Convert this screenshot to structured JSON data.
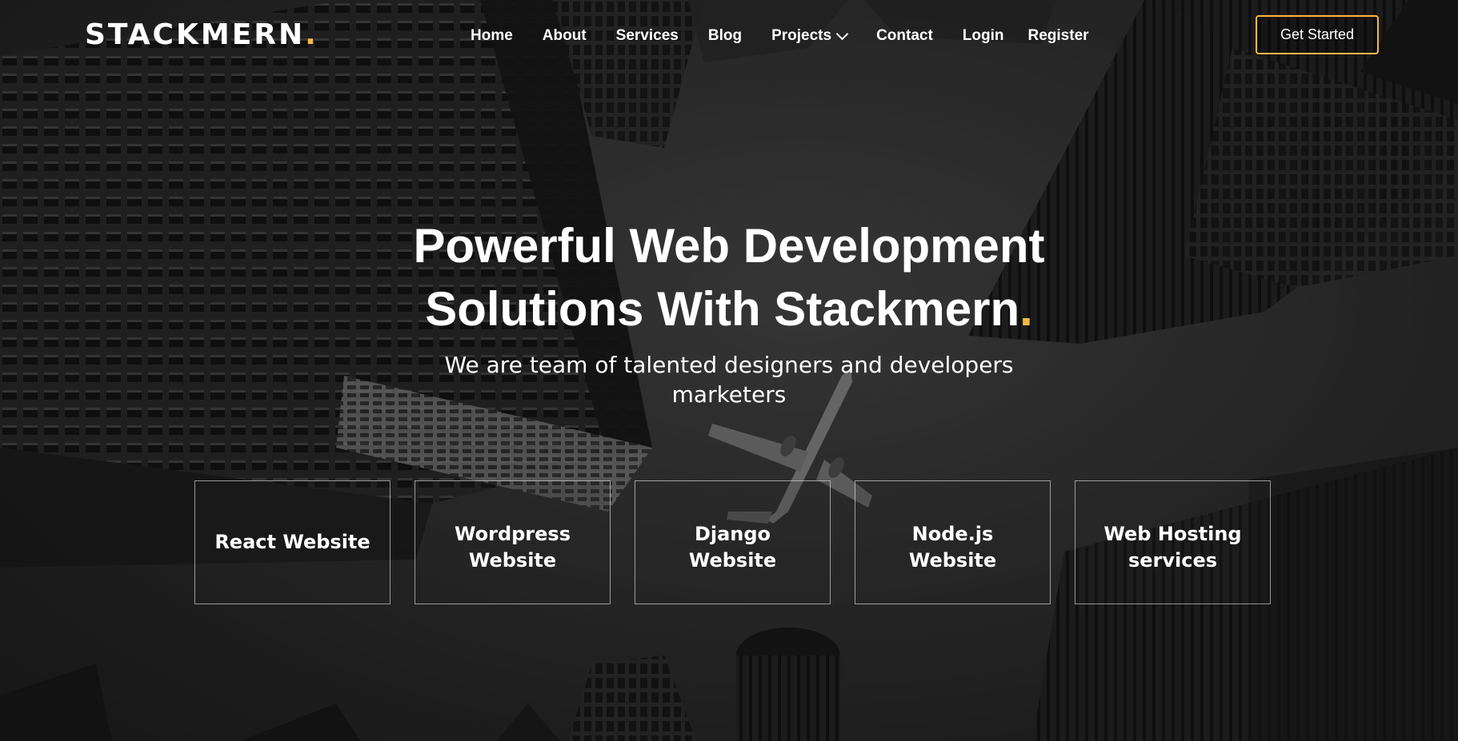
{
  "brand": {
    "name": "STACKMERN",
    "dot": ".",
    "accent_color": "#f5b942"
  },
  "nav": {
    "items": [
      {
        "label": "Home"
      },
      {
        "label": "About"
      },
      {
        "label": "Services"
      },
      {
        "label": "Blog"
      },
      {
        "label": "Projects",
        "icon": "chevron-down-icon"
      },
      {
        "label": "Contact"
      },
      {
        "label": "Login"
      },
      {
        "label": "Register"
      }
    ],
    "cta_label": "Get Started"
  },
  "hero": {
    "title_line1": "Powerful Web Development",
    "title_line2": "Solutions With Stackmern",
    "title_dot": ".",
    "subtitle_line1": "We are team of talented designers and developers",
    "subtitle_line2": "marketers"
  },
  "services": [
    {
      "label": "React Website"
    },
    {
      "label": "Wordpress Website"
    },
    {
      "label": "Django Website"
    },
    {
      "label": "Node.js Website"
    },
    {
      "label": "Web Hosting services"
    }
  ],
  "background": {
    "image": "black-and-white-skyscrapers-with-airplane"
  }
}
